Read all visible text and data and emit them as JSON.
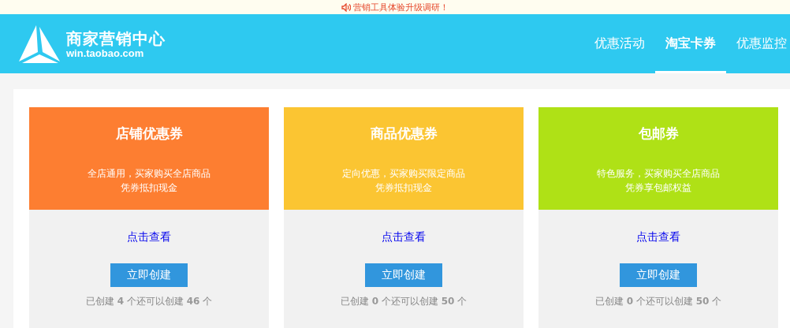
{
  "notice": {
    "text": "营销工具体验升级调研！"
  },
  "header": {
    "logo_title": "商家营销中心",
    "logo_url": "win.taobao.com"
  },
  "nav": [
    {
      "label": "优惠活动",
      "selected": false
    },
    {
      "label": "淘宝卡券",
      "selected": true
    },
    {
      "label": "优惠监控",
      "selected": false
    }
  ],
  "cards": [
    {
      "title": "店铺优惠券",
      "color": "#fd7e31",
      "description": [
        "全店通用，买家购买全店商品",
        "凭券抵扣现金"
      ],
      "link": "点击查看",
      "button": "立即创建",
      "count": "已创建 **4** 个还可以创建 **46** 个"
    },
    {
      "title": "商品优惠券",
      "color": "#fbc532",
      "description": [
        "定向优惠，买家购买限定商品",
        "凭券抵扣现金"
      ],
      "link": "点击查看",
      "button": "立即创建",
      "count": "已创建 **0** 个还可以创建 **50** 个"
    },
    {
      "title": "包邮券",
      "color": "#afe116",
      "description": [
        "特色服务，买家购买全店商品",
        "凭券享包邮权益"
      ],
      "link": "点击查看",
      "button": "立即创建",
      "count": "已创建 **0** 个还可以创建 **50** 个"
    }
  ]
}
